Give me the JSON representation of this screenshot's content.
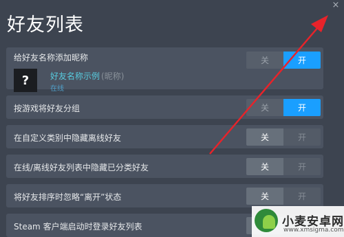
{
  "window": {
    "title": "好友列表",
    "close_icon": "×"
  },
  "settings": [
    {
      "label": "给好友名称添加昵称",
      "value": "on",
      "off_label": "关",
      "on_label": "开",
      "preview": {
        "icon": "?",
        "name": "好友名称示例",
        "nickname": "(昵称)",
        "status": "在线"
      }
    },
    {
      "label": "按游戏将好友分组",
      "value": "on",
      "off_label": "关",
      "on_label": "开"
    },
    {
      "label": "在自定义类别中隐藏离线好友",
      "value": "off",
      "off_label": "关",
      "on_label": "开"
    },
    {
      "label": "在线/离线好友列表中隐藏已分类好友",
      "value": "off",
      "off_label": "关",
      "on_label": "开"
    },
    {
      "label": "将好友排序时忽略“离开”状态",
      "value": "off",
      "off_label": "关",
      "on_label": "开"
    },
    {
      "label": "Steam 客户端启动时登录好友列表",
      "value": "off",
      "off_label": "关",
      "on_label": "开"
    }
  ],
  "colors": {
    "accent": "#1a9fff",
    "background": "#3d4450",
    "row": "#4b5361",
    "annotation_arrow": "#e8232a"
  },
  "watermark": {
    "text": "小麦安卓网",
    "url": "www.xmsigma.com"
  }
}
